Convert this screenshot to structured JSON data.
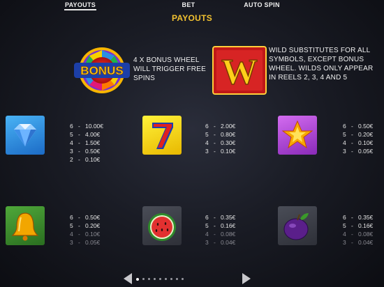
{
  "tabs": [
    {
      "label": "PAYOUTS",
      "active": true
    },
    {
      "label": "BET",
      "active": false
    },
    {
      "label": "AUTO SPIN",
      "active": false
    }
  ],
  "title": "PAYOUTS",
  "features": {
    "bonus": {
      "logo_text": "BONUS",
      "description": "4 X BONUS WHEEL WILL TRIGGER FREE SPINS"
    },
    "wild": {
      "logo_text": "W",
      "description": "WILD SUBSTITUTES FOR ALL SYMBOLS, EXCEPT BONUS WHEEL. WILDS ONLY APPEAR IN REELS 2, 3, 4 AND 5"
    }
  },
  "symbols": [
    {
      "name": "diamond",
      "icon": "diamond-icon",
      "bg": "#2b8fe0",
      "payouts": [
        {
          "count": "6",
          "amount": "10.00€"
        },
        {
          "count": "5",
          "amount": "4.00€"
        },
        {
          "count": "4",
          "amount": "1.50€"
        },
        {
          "count": "3",
          "amount": "0.50€"
        },
        {
          "count": "2",
          "amount": "0.10€"
        }
      ]
    },
    {
      "name": "seven",
      "icon": "seven-icon",
      "bg": "#f5d800",
      "payouts": [
        {
          "count": "6",
          "amount": "2.00€"
        },
        {
          "count": "5",
          "amount": "0.80€"
        },
        {
          "count": "4",
          "amount": "0.30€"
        },
        {
          "count": "3",
          "amount": "0.10€"
        }
      ]
    },
    {
      "name": "star",
      "icon": "star-icon",
      "bg": "#b24ad6",
      "payouts": [
        {
          "count": "6",
          "amount": "0.50€"
        },
        {
          "count": "5",
          "amount": "0.20€"
        },
        {
          "count": "4",
          "amount": "0.10€"
        },
        {
          "count": "3",
          "amount": "0.05€"
        }
      ]
    },
    {
      "name": "bell",
      "icon": "bell-icon",
      "bg": "#3a8a2c",
      "payouts": [
        {
          "count": "6",
          "amount": "0.50€"
        },
        {
          "count": "5",
          "amount": "0.20€"
        },
        {
          "count": "4",
          "amount": "0.10€"
        },
        {
          "count": "3",
          "amount": "0.05€"
        }
      ]
    },
    {
      "name": "watermelon",
      "icon": "watermelon-icon",
      "bg": "#3c3f48",
      "payouts": [
        {
          "count": "6",
          "amount": "0.35€"
        },
        {
          "count": "5",
          "amount": "0.16€"
        },
        {
          "count": "4",
          "amount": "0.08€"
        },
        {
          "count": "3",
          "amount": "0.04€"
        }
      ]
    },
    {
      "name": "plum",
      "icon": "plum-icon",
      "bg": "#3c3f48",
      "payouts": [
        {
          "count": "6",
          "amount": "0.35€"
        },
        {
          "count": "5",
          "amount": "0.16€"
        },
        {
          "count": "4",
          "amount": "0.08€"
        },
        {
          "count": "3",
          "amount": "0.04€"
        }
      ]
    }
  ],
  "pager": {
    "total_pages": 9,
    "current_page": 1,
    "prev_icon": "triangle-left-icon",
    "next_icon": "triangle-right-icon"
  },
  "colors": {
    "title": "#f2c230",
    "dim_text": "#8a8a92"
  }
}
